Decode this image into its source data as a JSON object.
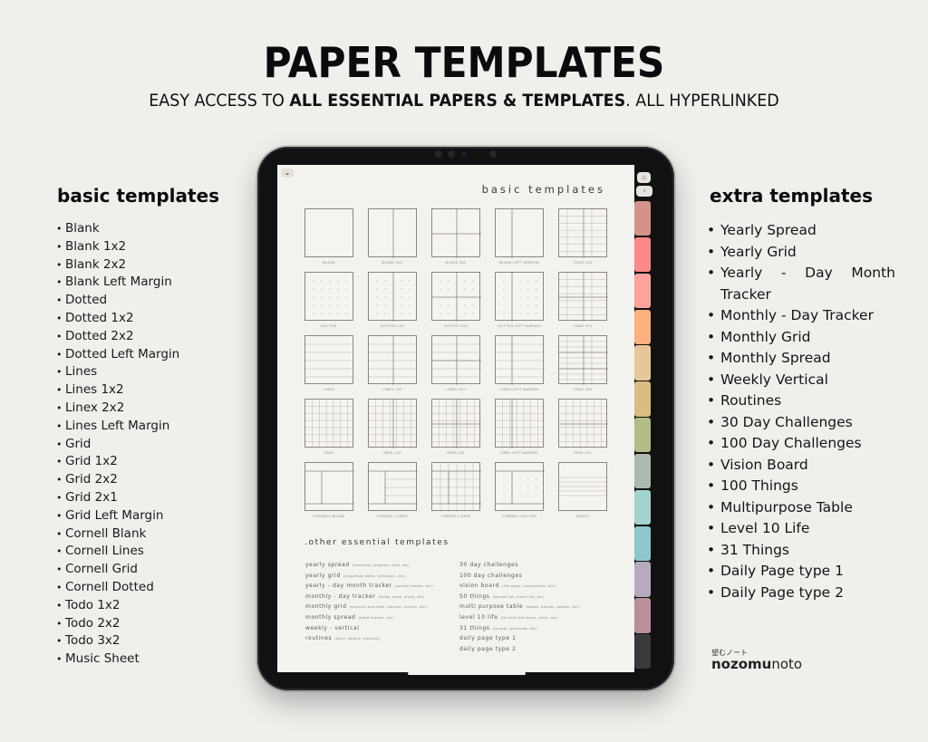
{
  "header": {
    "title": "PAPER TEMPLATES",
    "subtitle_pre": "EASY ACCESS TO ",
    "subtitle_bold": "ALL ESSENTIAL PAPERS & TEMPLATES",
    "subtitle_post": ". ALL HYPERLINKED"
  },
  "left_panel": {
    "title": "basic templates",
    "items": [
      "Blank",
      "Blank 1x2",
      "Blank 2x2",
      "Blank Left Margin",
      "Dotted",
      "Dotted 1x2",
      "Dotted 2x2",
      "Dotted Left Margin",
      "Lines",
      "Lines 1x2",
      "Linex 2x2",
      "Lines Left Margin",
      "Grid",
      "Grid 1x2",
      "Grid 2x2",
      "Grid 2x1",
      "Grid Left Margin",
      "Cornell Blank",
      "Cornell Lines",
      "Cornell Grid",
      "Cornell Dotted",
      "Todo 1x2",
      "Todo 2x2",
      "Todo 3x2",
      "Music Sheet"
    ]
  },
  "right_panel": {
    "title": "extra templates",
    "items": [
      "Yearly Spread",
      "Yearly Grid",
      "Yearly - Day Month Tracker",
      "Monthly - Day Tracker",
      "Monthly Grid",
      "Monthly Spread",
      "Weekly Vertical",
      "Routines",
      "30 Day Challenges",
      "100 Day Challenges",
      "Vision Board",
      "100 Things",
      "Multipurpose Table",
      "Level 10 Life",
      "31 Things",
      "Daily Page type 1",
      "Daily Page type 2"
    ]
  },
  "tablet": {
    "page_title": "basic templates",
    "collapse_icon": "chevron-down-icon",
    "side_icons": [
      "home-icon",
      "square-icon"
    ],
    "templates": [
      {
        "label": "BLANK",
        "kind": "blank"
      },
      {
        "label": "BLANK 1X2",
        "kind": "blank12"
      },
      {
        "label": "BLANK 2X2",
        "kind": "blank22"
      },
      {
        "label": "BLANK LEFT MARGIN",
        "kind": "blanklm"
      },
      {
        "label": "TODO 1X2",
        "kind": "todo12"
      },
      {
        "label": "DOTTED",
        "kind": "dotted"
      },
      {
        "label": "DOTTED 1X2",
        "kind": "dotted12"
      },
      {
        "label": "DOTTED 2X2",
        "kind": "dotted22"
      },
      {
        "label": "DOTTED LEFT MARGIN",
        "kind": "dottedlm"
      },
      {
        "label": "TODO 2X2",
        "kind": "todo22"
      },
      {
        "label": "LINES",
        "kind": "lines"
      },
      {
        "label": "LINES 1X2",
        "kind": "lines12"
      },
      {
        "label": "LINES 2X2",
        "kind": "lines22"
      },
      {
        "label": "LINES LEFT MARGIN",
        "kind": "lineslm"
      },
      {
        "label": "TODO 3X2",
        "kind": "todo32"
      },
      {
        "label": "GRID",
        "kind": "grid"
      },
      {
        "label": "GRID 1X2",
        "kind": "grid12"
      },
      {
        "label": "GRID 2X2",
        "kind": "grid22"
      },
      {
        "label": "GRID LEFT MARGIN",
        "kind": "gridlm"
      },
      {
        "label": "GRID 2X1",
        "kind": "grid21"
      },
      {
        "label": "CORNELL BLANK",
        "kind": "cornellblank"
      },
      {
        "label": "CORNELL LINES",
        "kind": "cornelllines"
      },
      {
        "label": "CORNELL GRID",
        "kind": "cornellgrid"
      },
      {
        "label": "CORNELL DOTTED",
        "kind": "cornelldotted"
      },
      {
        "label": "MUSIC",
        "kind": "music"
      }
    ],
    "other_title": ".other essential templates",
    "other_left": [
      {
        "name": "yearly spread",
        "note": "(checklist, progress, bills, etc)"
      },
      {
        "name": "yearly grid",
        "note": "(important dates, birthdays, etc)"
      },
      {
        "name": "yearly - day month tracker",
        "note": "(period tracker, etc)"
      },
      {
        "name": "monthly - day tracker",
        "note": "(sleep, work, study, etc)"
      },
      {
        "name": "monthly grid",
        "note": "(monthly overview, planner, events, etc)"
      },
      {
        "name": "monthly spread",
        "note": "(habit tracker, etc)"
      },
      {
        "name": "weekly - vertical",
        "note": ""
      },
      {
        "name": "routines",
        "note": "(daily, weekly, monthly)"
      }
    ],
    "other_right": [
      {
        "name": "30 day challenges",
        "note": ""
      },
      {
        "name": "100 day challenges",
        "note": ""
      },
      {
        "name": "vision board",
        "note": "(life goals, inspirations, etc)"
      },
      {
        "name": "50 things",
        "note": "(bucket list, travel list, etc)"
      },
      {
        "name": "multi purpose table",
        "note": "(books, movies, games, etc)"
      },
      {
        "name": "level 10 life",
        "note": "(to track life areas, skills, etc)"
      },
      {
        "name": "31 things",
        "note": "(journal, gratitude, etc)"
      },
      {
        "name": "daily page type 1",
        "note": ""
      },
      {
        "name": "daily page type 2",
        "note": ""
      }
    ],
    "tab_colors": [
      "#d4928a",
      "#fd8a88",
      "#fca39e",
      "#fdb07f",
      "#e6c795",
      "#d8bd82",
      "#b3bc86",
      "#a9bcaf",
      "#a3d3cf",
      "#8fc7cf",
      "#b7a9c0",
      "#bb8f9a",
      "#3a3a3a"
    ]
  },
  "brand": {
    "jp": "望むノート",
    "bold": "nozomu",
    "light": "noto"
  }
}
